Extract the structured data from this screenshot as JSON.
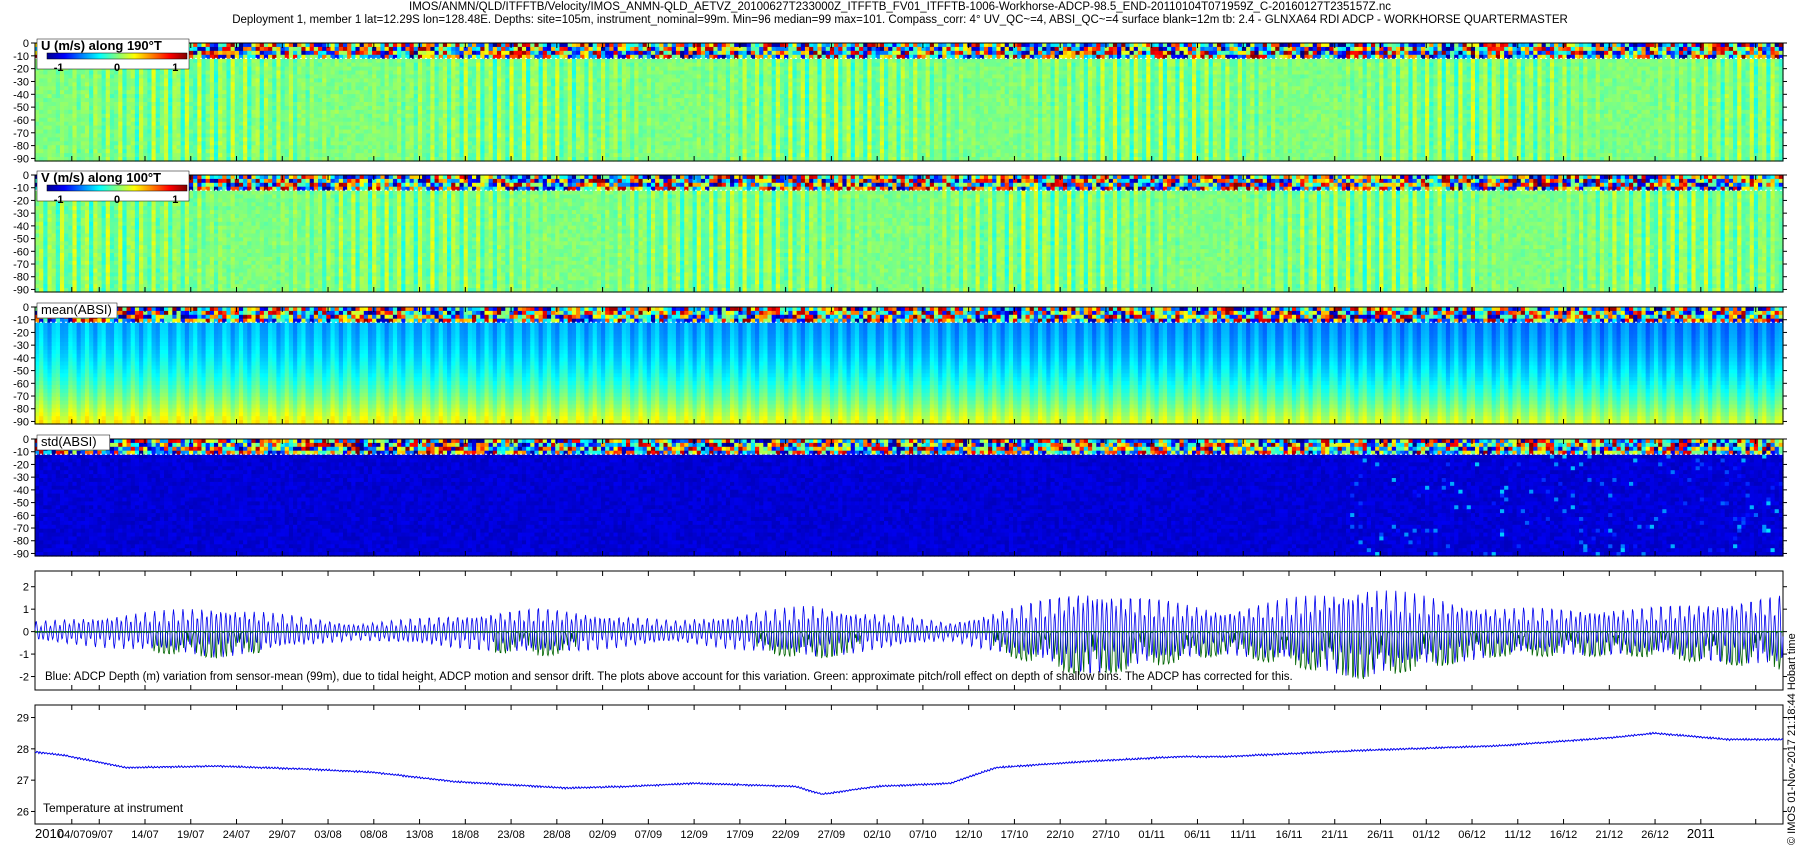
{
  "header": {
    "file_path": "IMOS/ANMN/QLD/ITFFTB/Velocity/IMOS_ANMN-QLD_AETVZ_20100627T233000Z_ITFFTB_FV01_ITFFTB-1006-Workhorse-ADCP-98.5_END-20110104T071959Z_C-20160127T235157Z.nc",
    "deployment_info": "Deployment 1, member 1 lat=12.29S lon=128.48E. Depths: site=105m, instrument_nominal=99m. Min=96 median=99 max=101. Compass_corr: 4° UV_QC~=4, ABSI_QC~=4 surface blank=12m tb: 2.4 - GLNXA64 RDI ADCP - WORKHORSE QUARTERMASTER"
  },
  "footer": {
    "side_label": "© IMOS 01-Nov-2017 21:18:44 Hobart time"
  },
  "colors": {
    "blue_series": "#0000ee",
    "green_series": "#006400",
    "grid": "#000000",
    "guide_dotted": "#ffffff"
  },
  "chart_data": [
    {
      "type": "heatmap",
      "id": "u",
      "title": "U (m/s) along 190°T",
      "colorbar": {
        "ticks": [
          "-1",
          "0",
          "1"
        ],
        "range": [
          -1.2,
          1.2
        ]
      },
      "ylim": [
        -92,
        0
      ],
      "yticks": [
        "0",
        "-10",
        "-20",
        "-30",
        "-40",
        "-50",
        "-60",
        "-70",
        "-80",
        "-90"
      ],
      "surface_blank_depth": -12,
      "pattern": "near-zero velocities (green) with dense tidal banding; noisy values above -12 m"
    },
    {
      "type": "heatmap",
      "id": "v",
      "title": "V (m/s) along 100°T",
      "colorbar": {
        "ticks": [
          "-1",
          "0",
          "1"
        ],
        "range": [
          -1.2,
          1.2
        ]
      },
      "ylim": [
        -92,
        0
      ],
      "yticks": [
        "0",
        "-10",
        "-20",
        "-30",
        "-40",
        "-50",
        "-60",
        "-70",
        "-80",
        "-90"
      ],
      "surface_blank_depth": -12,
      "pattern": "near-zero velocities (green) with dense tidal banding; noisy values above -12 m"
    },
    {
      "type": "heatmap",
      "id": "mean_absi",
      "title": "mean(ABSI)",
      "ylim": [
        -92,
        0
      ],
      "yticks": [
        "0",
        "-10",
        "-20",
        "-30",
        "-40",
        "-50",
        "-60",
        "-70",
        "-80",
        "-90"
      ],
      "surface_blank_depth": -12,
      "pattern": "cyan/blue at mid depth, green-yellow near instrument at -90 m, red at surface"
    },
    {
      "type": "heatmap",
      "id": "std_absi",
      "title": "std(ABSI)",
      "ylim": [
        -92,
        0
      ],
      "yticks": [
        "0",
        "-10",
        "-20",
        "-30",
        "-40",
        "-50",
        "-60",
        "-70",
        "-80",
        "-90"
      ],
      "surface_blank_depth": -12,
      "pattern": "mostly dark blue, cyan streaks late in record, noisy above -12 m"
    },
    {
      "type": "line",
      "id": "depth",
      "title": "",
      "ylim": [
        -2.6,
        2.7
      ],
      "yticks": [
        "2",
        "1",
        "0",
        "-1",
        "-2"
      ],
      "annotation": "Blue: ADCP Depth (m) variation from sensor-mean (99m), due to tidal height, ADCP motion and sensor drift. The plots above account for this variation. Green: approximate pitch/roll effect on depth of shallow bins. The ADCP has corrected for this.",
      "series": [
        {
          "name": "Blue",
          "envelope_day": [
            0,
            20,
            35,
            55,
            70,
            85,
            100,
            115,
            130,
            145,
            160,
            175,
            191
          ],
          "amplitude": [
            0.55,
            1.4,
            0.45,
            1.3,
            0.6,
            1.45,
            0.5,
            2.4,
            1.2,
            2.5,
            1.3,
            1.3,
            2.0
          ]
        },
        {
          "name": "Green",
          "note": "downward spikes to about -2 concentrated at spring tides"
        }
      ]
    },
    {
      "type": "line",
      "id": "temperature",
      "title": "",
      "annotation": "Temperature at instrument",
      "ylim": [
        25.6,
        29.4
      ],
      "yticks": [
        "29",
        "28",
        "27",
        "26"
      ],
      "series": [
        {
          "name": "Temperature at instrument",
          "x_day": [
            0,
            3,
            10,
            20,
            30,
            37,
            46,
            58,
            65,
            72,
            83,
            86,
            92,
            100,
            105,
            115,
            125,
            130,
            145,
            160,
            172,
            177,
            185,
            191
          ],
          "y": [
            27.9,
            27.8,
            27.4,
            27.45,
            27.35,
            27.25,
            26.95,
            26.75,
            26.8,
            26.9,
            26.8,
            26.55,
            26.8,
            26.9,
            27.4,
            27.6,
            27.75,
            27.75,
            27.95,
            28.1,
            28.35,
            28.5,
            28.3,
            28.3
          ]
        }
      ]
    }
  ],
  "time_axis": {
    "start_date": "2010-06-27",
    "end_date": "2011-01-04",
    "tick_labels": [
      "2010",
      "04/07",
      "09/07",
      "14/07",
      "19/07",
      "24/07",
      "29/07",
      "03/08",
      "08/08",
      "13/08",
      "18/08",
      "23/08",
      "28/08",
      "02/09",
      "07/09",
      "12/09",
      "17/09",
      "22/09",
      "27/09",
      "02/10",
      "07/10",
      "12/10",
      "17/10",
      "22/10",
      "27/10",
      "01/11",
      "06/11",
      "11/11",
      "16/11",
      "21/11",
      "26/11",
      "01/12",
      "06/12",
      "11/12",
      "16/12",
      "21/12",
      "26/12",
      "2011"
    ],
    "tick_days": [
      4.02,
      7.02,
      12.02,
      17.02,
      22.02,
      27.02,
      32.02,
      37.02,
      42.02,
      47.02,
      52.02,
      57.02,
      62.02,
      67.02,
      72.02,
      77.02,
      82.02,
      87.02,
      92.02,
      97.02,
      102.02,
      107.02,
      112.02,
      117.02,
      122.02,
      127.02,
      132.02,
      137.02,
      142.02,
      147.02,
      152.02,
      157.02,
      162.02,
      167.02,
      172.02,
      177.02,
      182.02,
      188.02
    ]
  }
}
